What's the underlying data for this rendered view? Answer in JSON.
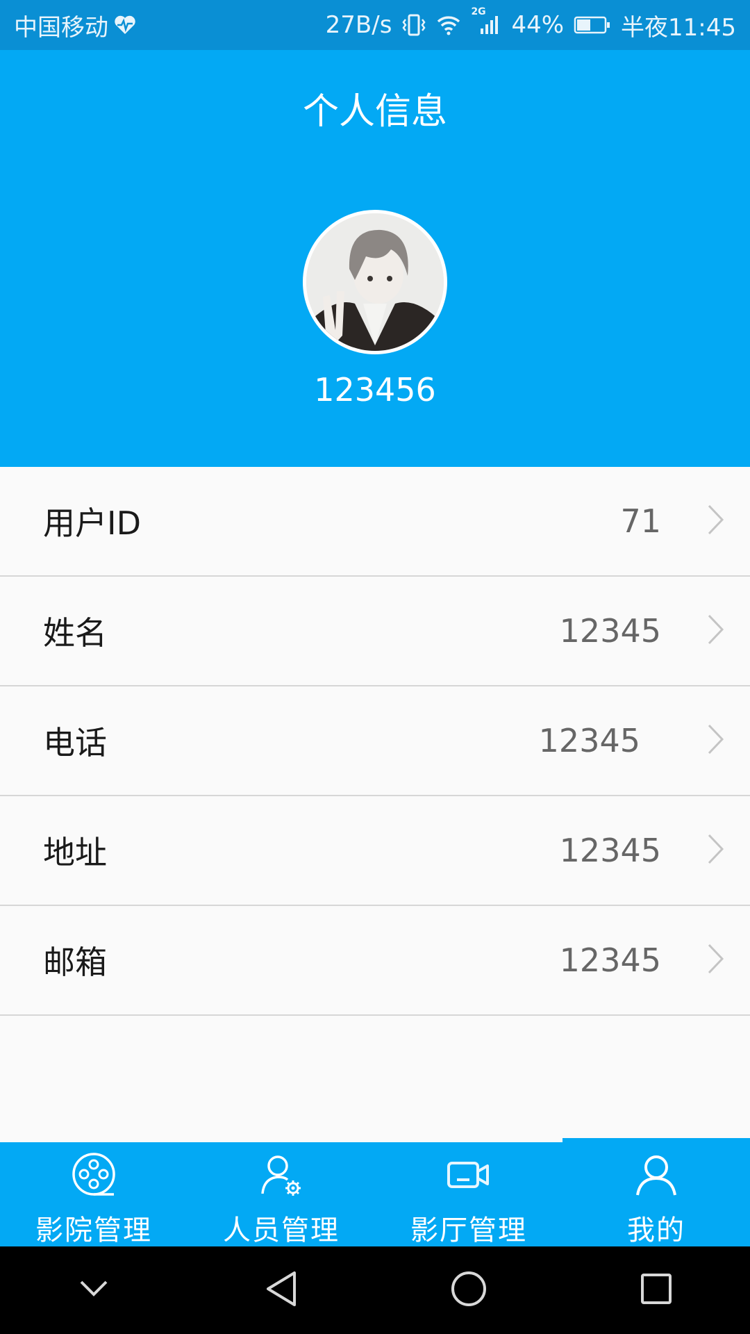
{
  "status_bar": {
    "carrier": "中国移动",
    "speed": "27B/s",
    "network": "2G",
    "battery": "44%",
    "time": "半夜11:45"
  },
  "header": {
    "title": "个人信息",
    "username": "123456"
  },
  "info_rows": [
    {
      "label": "用户ID",
      "value": "71"
    },
    {
      "label": "姓名",
      "value": "12345"
    },
    {
      "label": "电话",
      "value": "12345"
    },
    {
      "label": "地址",
      "value": "12345"
    },
    {
      "label": "邮箱",
      "value": "12345"
    }
  ],
  "tabs": [
    {
      "label": "影院管理",
      "icon": "film-reel-icon"
    },
    {
      "label": "人员管理",
      "icon": "person-settings-icon"
    },
    {
      "label": "影厅管理",
      "icon": "video-camera-icon"
    },
    {
      "label": "我的",
      "icon": "person-icon"
    }
  ],
  "active_tab": "我的",
  "colors": {
    "primary": "#03a9f4",
    "status_bar": "#0a8fd4",
    "background": "#fafafa",
    "divider": "#d6d6d6"
  }
}
